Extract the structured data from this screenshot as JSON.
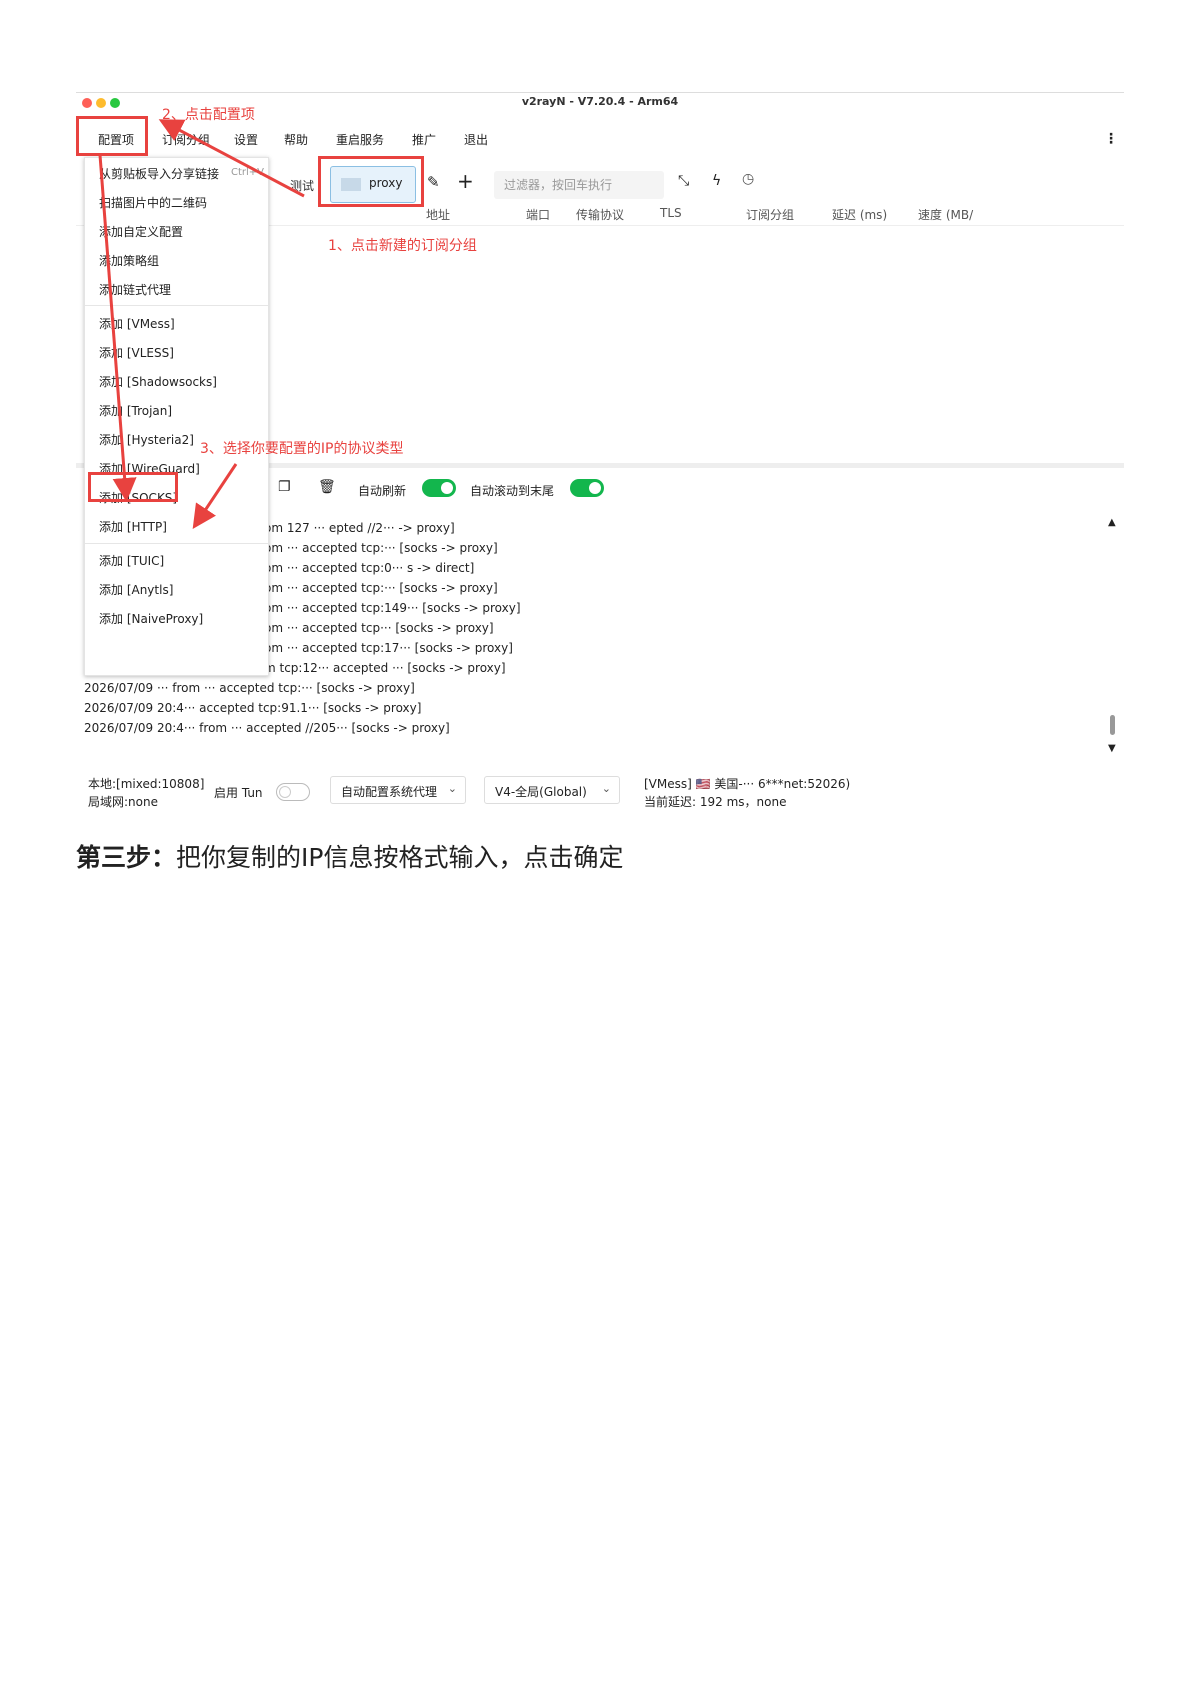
{
  "window": {
    "title": "v2rayN - V7.20.4 - Arm64"
  },
  "menu": [
    {
      "label": "配置项"
    },
    {
      "label": "订阅分组"
    },
    {
      "label": "设置"
    },
    {
      "label": "帮助"
    },
    {
      "label": "重启服务"
    },
    {
      "label": "推广"
    },
    {
      "label": "退出"
    }
  ],
  "toolbar": {
    "test_label": "测试",
    "proxy_label": "proxy",
    "search_placeholder": "过滤器，按回车执行"
  },
  "table_headers": [
    "地址",
    "端口",
    "传输协议",
    "TLS",
    "订阅分组",
    "延迟 (ms)",
    "速度 (MB/"
  ],
  "dropdown": {
    "items": [
      "从剪贴板导入分享链接",
      "扫描图片中的二维码",
      "添加自定义配置",
      "添加策略组",
      "添加链式代理",
      "添加 [VMess]",
      "添加 [VLESS]",
      "添加 [Shadowsocks]",
      "添加 [Trojan]",
      "添加 [Hysteria2]",
      "添加 [WireGuard]",
      "添加 [SOCKS]",
      "添加 [HTTP]",
      "添加 [TUIC]",
      "添加 [Anytls]",
      "添加 [NaiveProxy]"
    ],
    "shortcut": "Ctrl+V"
  },
  "annotations": {
    "step1": "1、点击新建的订阅分组",
    "step2": "2、点击配置项",
    "step3": "3、选择你要配置的IP的协议类型"
  },
  "log_toolbar": {
    "auto_refresh": "自动刷新",
    "auto_scroll": "自动滚动到末尾"
  },
  "log_lines": [
    "om 127 ··· epted //2··· -> proxy]",
    "om ··· accepted tcp:··· [socks -> proxy]",
    "om ··· accepted tcp:0··· s -> direct]",
    "om ··· accepted tcp:··· [socks -> proxy]",
    "om ··· accepted tcp:149··· [socks -> proxy]",
    "om ··· accepted tcp··· [socks -> proxy]",
    "om ··· accepted tcp:17··· [socks -> proxy]",
    "m tcp:12··· accepted ··· [socks -> proxy]",
    "2026/07/09 ··· from ··· accepted tcp:··· [socks -> proxy]",
    "2026/07/09 20:4··· accepted tcp:91.1··· [socks -> proxy]",
    "2026/07/09 20:4··· from ··· accepted //205··· [socks -> proxy]"
  ],
  "status_bar": {
    "local": "本地:[mixed:10808]",
    "lan": "局域网:none",
    "tun_label": "启用 Tun",
    "sysproxy": "自动配置系统代理",
    "routing": "V4-全局(Global)",
    "server": "[VMess] 🇺🇸 美国-··· 6***net:52026)",
    "latency": "当前延迟: 192 ms，none"
  },
  "caption": {
    "bold": "第三步：",
    "text": "把你复制的IP信息按格式输入，点击确定"
  },
  "colors": {
    "annotation": "#e8423f",
    "toggle_on": "#13b64d"
  }
}
